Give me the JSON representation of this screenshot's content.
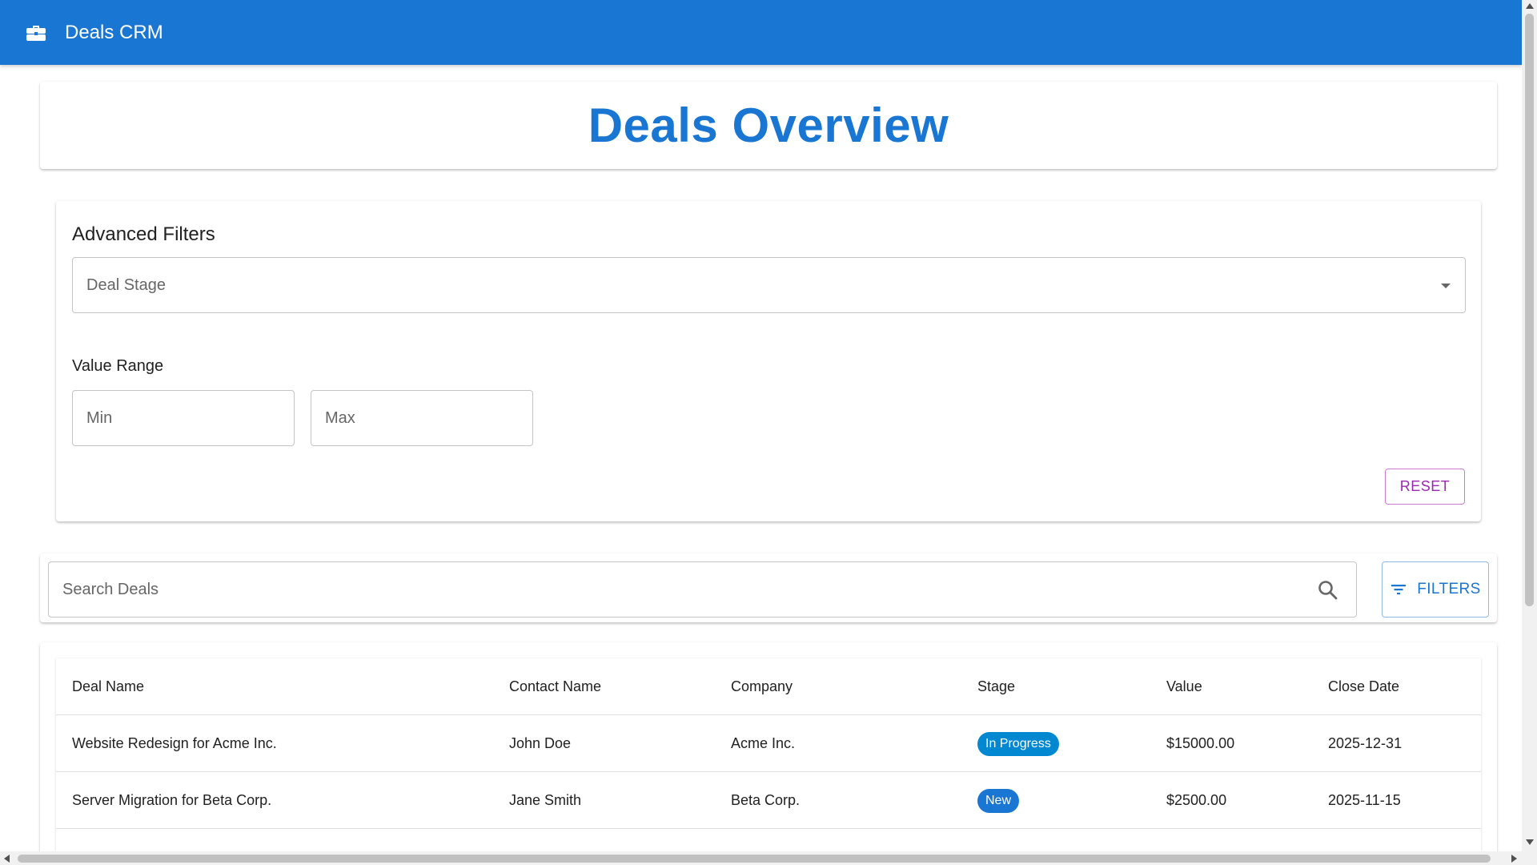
{
  "appbar": {
    "title": "Deals CRM",
    "icon": "briefcase-icon"
  },
  "overview": {
    "title": "Deals Overview"
  },
  "filters": {
    "heading": "Advanced Filters",
    "stage_placeholder": "Deal Stage",
    "range_label": "Value Range",
    "min_placeholder": "Min",
    "max_placeholder": "Max",
    "reset_label": "RESET"
  },
  "search": {
    "placeholder": "Search Deals",
    "filters_label": "FILTERS"
  },
  "table": {
    "headers": [
      "Deal Name",
      "Contact Name",
      "Company",
      "Stage",
      "Value",
      "Close Date"
    ],
    "rows": [
      {
        "deal": "Website Redesign for Acme Inc.",
        "contact": "John Doe",
        "company": "Acme Inc.",
        "stage": "In Progress",
        "value": "$15000.00",
        "close": "2025-12-31"
      },
      {
        "deal": "Server Migration for Beta Corp.",
        "contact": "Jane Smith",
        "company": "Beta Corp.",
        "stage": "New",
        "value": "$2500.00",
        "close": "2025-11-15"
      }
    ]
  },
  "colors": {
    "primary": "#1976d2",
    "secondary": "#9c27b0",
    "stage_in_progress": "#0288d1",
    "stage_new": "#1976d2",
    "stage_won": "#2e7d32"
  }
}
